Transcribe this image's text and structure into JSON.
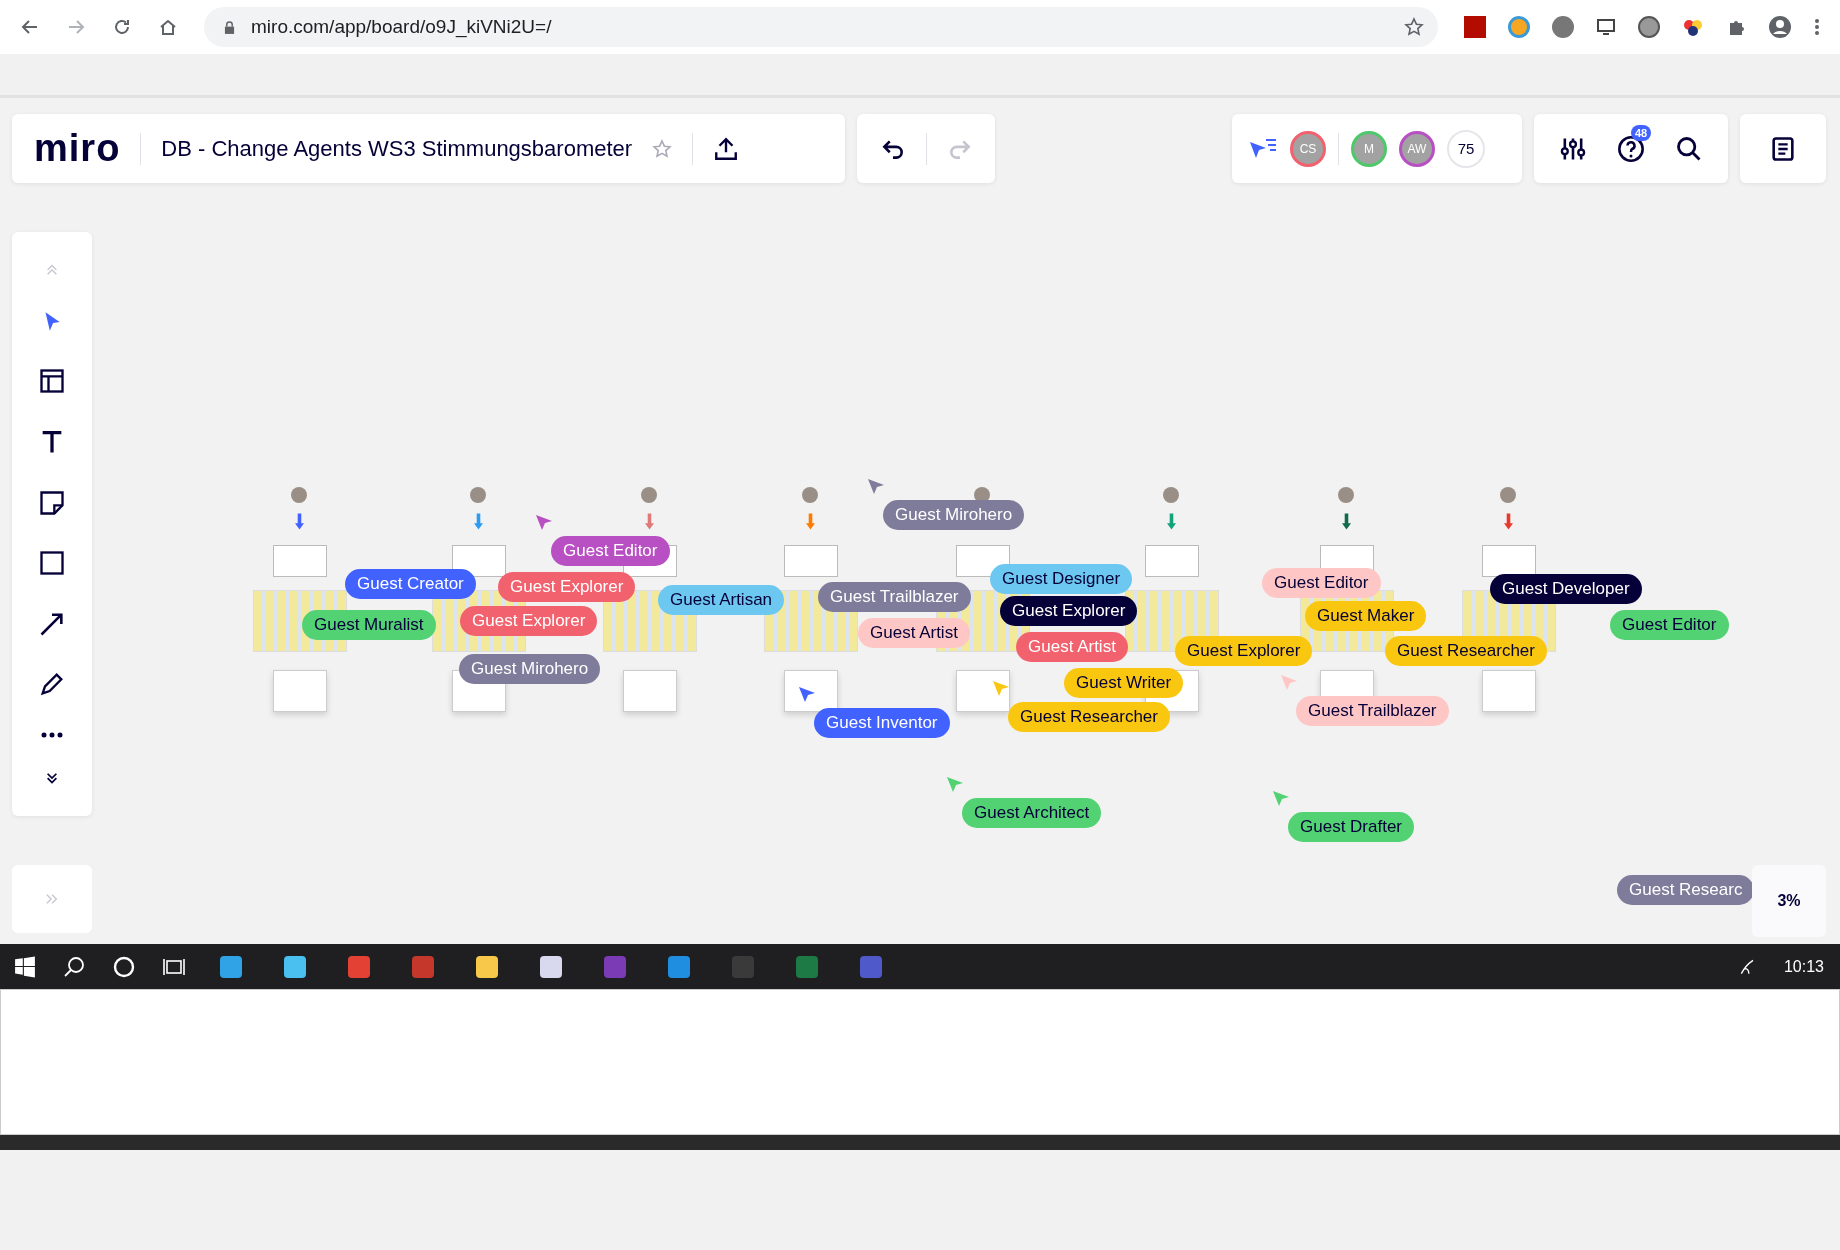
{
  "browser": {
    "url": "miro.com/app/board/o9J_kiVNi2U=/"
  },
  "board": {
    "logo": "miro",
    "title": "DB - Change Agents WS3 Stimmungsbarometer",
    "starred": false
  },
  "history": {
    "undo_disabled": false,
    "redo_disabled": true
  },
  "collaborators": [
    {
      "initials": "CS",
      "color": "#f2626e"
    },
    {
      "initials": "M",
      "color": "#4dc86a"
    },
    {
      "initials": "AW",
      "color": "#b84fc2"
    }
  ],
  "collaborator_count": "75",
  "help_badge": "48",
  "cursors": [
    {
      "name": "Guest Mirohero",
      "color": "#7f7b9a"
    },
    {
      "name": "Guest Editor",
      "color": "#b84fc2"
    },
    {
      "name": "Guest Creator",
      "color": "#4262ff"
    },
    {
      "name": "Guest Explorer",
      "color": "#f2626e"
    },
    {
      "name": "Guest Explorer",
      "color": "#f2626e"
    },
    {
      "name": "Guest Artisan",
      "color": "#6cc8f0"
    },
    {
      "name": "Guest Trailblazer",
      "color": "#7f7b9a"
    },
    {
      "name": "Guest Designer",
      "color": "#6cc8f0"
    },
    {
      "name": "Guest Explorer",
      "color": "#050038"
    },
    {
      "name": "Guest Artist",
      "color": "#ffc6c6"
    },
    {
      "name": "Guest Artist",
      "color": "#f2626e"
    },
    {
      "name": "Guest Writer",
      "color": "#fac710"
    },
    {
      "name": "Guest Researcher",
      "color": "#fac710"
    },
    {
      "name": "Guest Inventor",
      "color": "#4262ff"
    },
    {
      "name": "Guest Mirohero",
      "color": "#7f7b9a"
    },
    {
      "name": "Guest Muralist",
      "color": "#52d273"
    },
    {
      "name": "Guest Editor",
      "color": "#ffc6c6"
    },
    {
      "name": "Guest Maker",
      "color": "#fac710"
    },
    {
      "name": "Guest Explorer",
      "color": "#fac710"
    },
    {
      "name": "Guest Developer",
      "color": "#050038"
    },
    {
      "name": "Guest Editor",
      "color": "#52d273"
    },
    {
      "name": "Guest Researcher",
      "color": "#fac710"
    },
    {
      "name": "Guest Trailblazer",
      "color": "#ffc6c6"
    },
    {
      "name": "Guest Architect",
      "color": "#52d273"
    },
    {
      "name": "Guest Drafter",
      "color": "#52d273"
    },
    {
      "name": "Guest Researc",
      "color": "#7f7b9a"
    }
  ],
  "zoom": "3%",
  "taskbar": {
    "time": "10:13"
  }
}
